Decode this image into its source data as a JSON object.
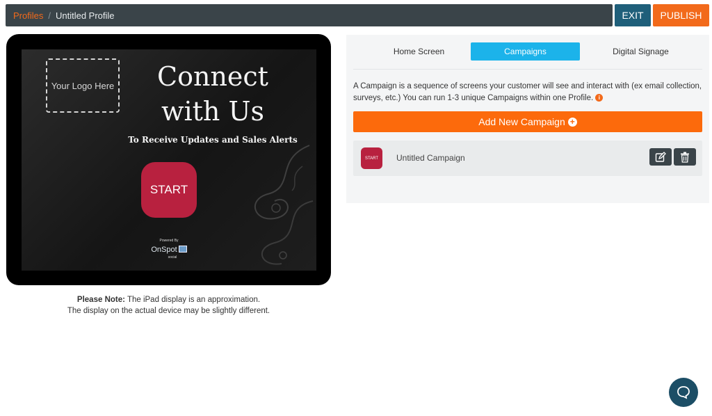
{
  "breadcrumb": {
    "root": "Profiles",
    "separator": "/",
    "current": "Untitled Profile"
  },
  "toolbar": {
    "exit_label": "EXIT",
    "publish_label": "PUBLISH"
  },
  "preview": {
    "logo_placeholder": "Your Logo Here",
    "headline_line1": "Connect",
    "headline_line2": "with Us",
    "subheadline": "To Receive Updates and Sales Alerts",
    "start_label": "START",
    "powered_by": "Powered By",
    "brand": "OnSpot",
    "brand_sub": "social"
  },
  "note": {
    "bold": "Please Note:",
    "line1": " The iPad display is an approximation.",
    "line2": "The display on the actual device may be slightly different."
  },
  "tabs": [
    {
      "label": "Home Screen",
      "active": false
    },
    {
      "label": "Campaigns",
      "active": true
    },
    {
      "label": "Digital Signage",
      "active": false
    }
  ],
  "campaigns_panel": {
    "description": "A Campaign is a sequence of screens your customer will see and interact with (ex email collection, surveys, etc.) You can run 1-3 unique Campaigns within one Profile.",
    "add_button_label": "Add New Campaign",
    "items": [
      {
        "thumb_label": "START",
        "name": "Untitled Campaign"
      }
    ]
  },
  "colors": {
    "accent_orange": "#f26a1b",
    "tab_active": "#1cb3ea",
    "dark_bar": "#3a4449",
    "start_red": "#b8213f"
  }
}
